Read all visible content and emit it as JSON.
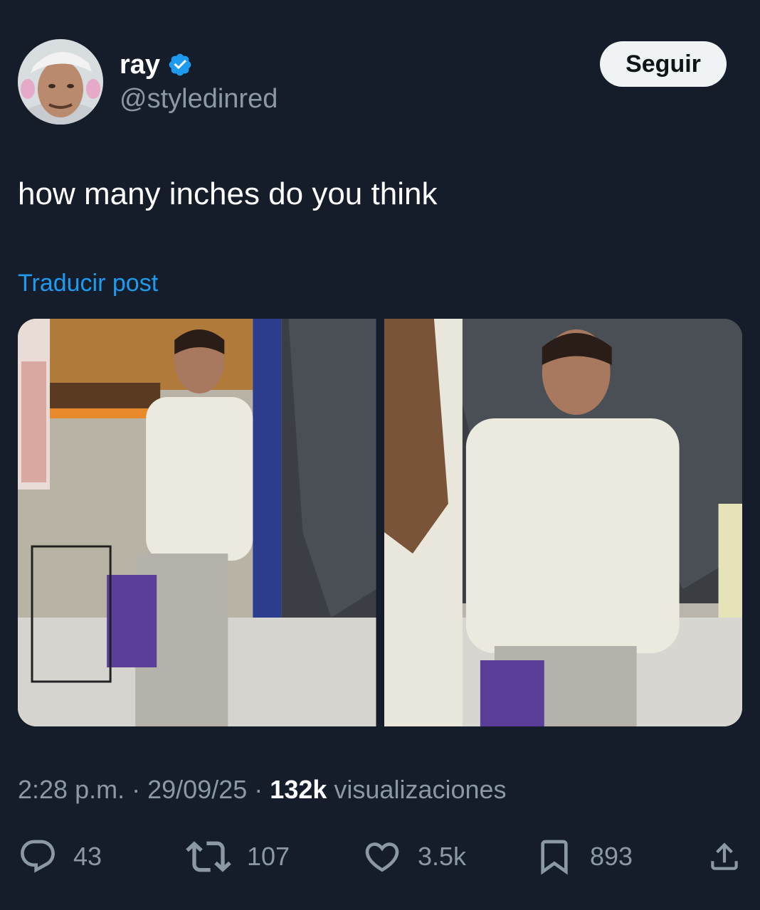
{
  "author": {
    "display_name": "ray",
    "handle": "@styledinred",
    "verified": true
  },
  "follow_button_label": "Seguir",
  "tweet_text": "how many inches do you think",
  "translate_label": "Traducir post",
  "meta": {
    "time": "2:28 p.m.",
    "separator": "·",
    "date": "29/09/25",
    "views_count": "132k",
    "views_label": "visualizaciones"
  },
  "actions": {
    "replies": "43",
    "reposts": "107",
    "likes": "3.5k",
    "bookmarks": "893"
  },
  "colors": {
    "background": "#151d2a",
    "accent": "#1d9bf0",
    "muted": "#8b98a5",
    "text": "#e7e9ea"
  },
  "icons": [
    "verified-badge-icon",
    "reply-icon",
    "repost-icon",
    "like-icon",
    "bookmark-icon",
    "share-icon"
  ]
}
